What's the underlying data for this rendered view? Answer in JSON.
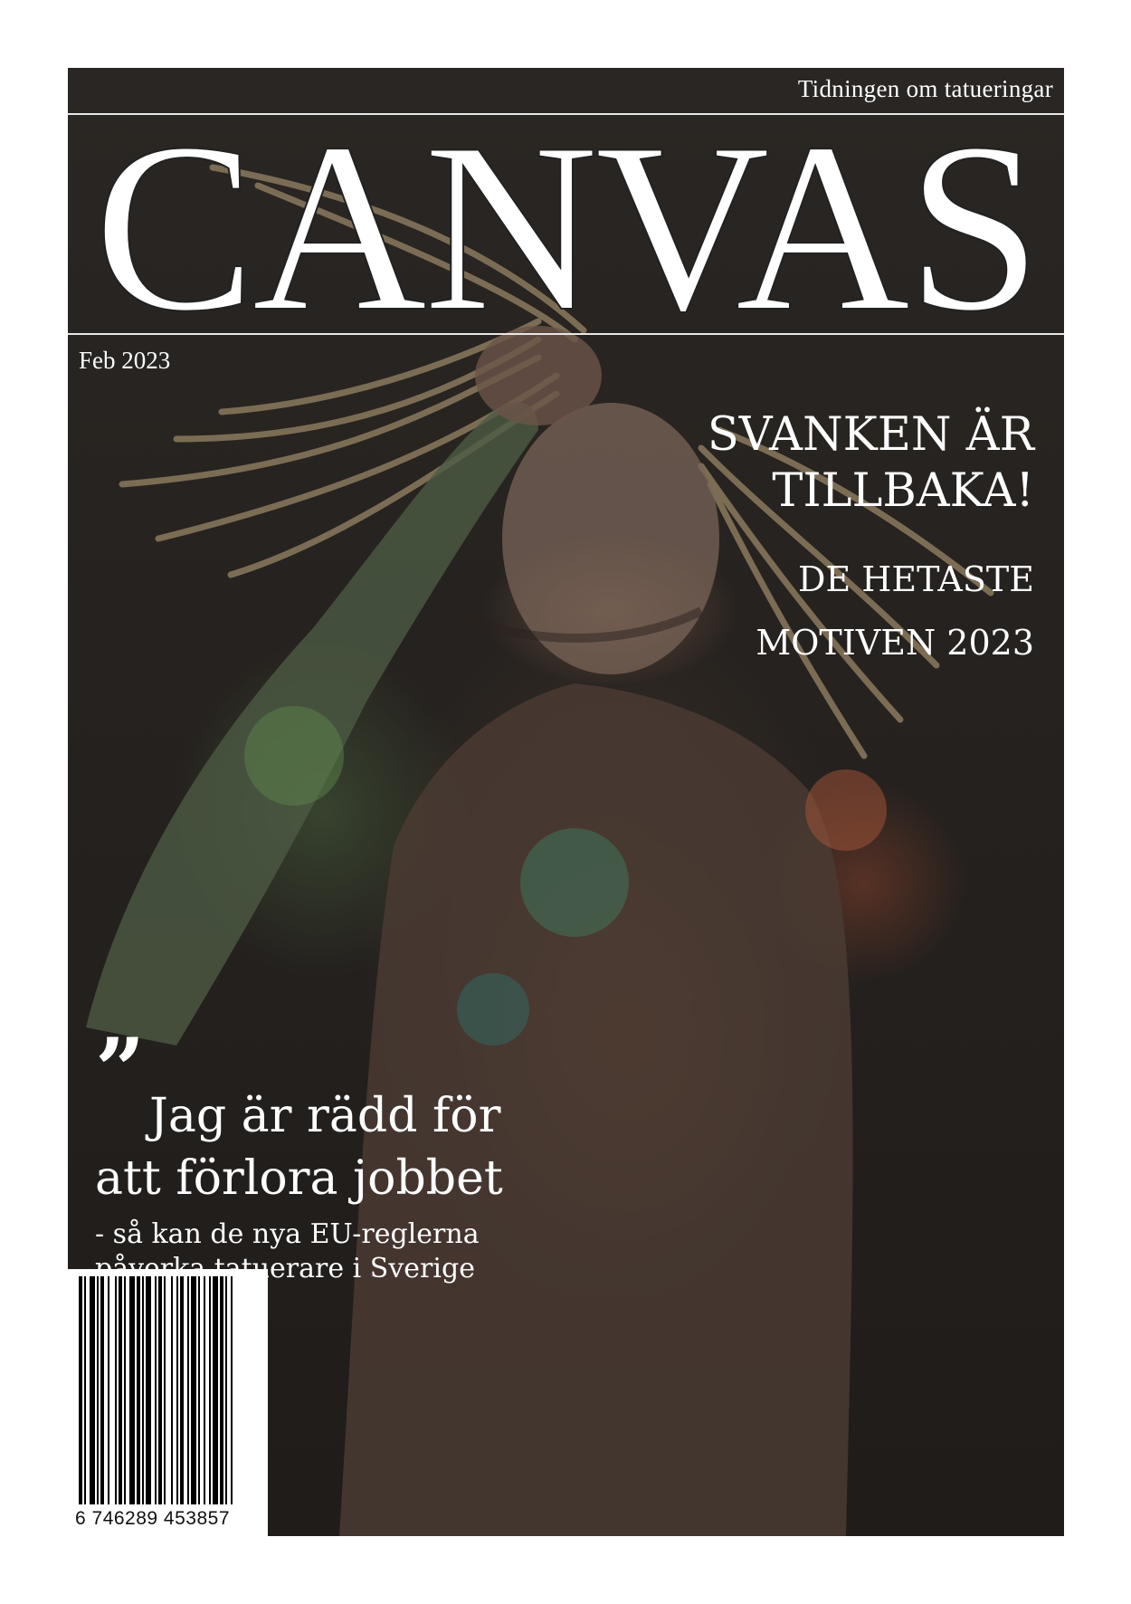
{
  "header": {
    "tagline": "Tidningen om tatueringar",
    "masthead": "CANVAS",
    "issue_date": "Feb 2023"
  },
  "cover_lines": {
    "headline_line1": "SVANKEN ÄR",
    "headline_line2": "TILLBAKA!",
    "subhead_line1": "DE HETASTE",
    "subhead_line2": "MOTIVEN 2023"
  },
  "feature": {
    "quote_mark": "”",
    "quote_line1": "Jag är rädd för",
    "quote_line2": "att förlora jobbet",
    "sub_line1": "- så kan de nya EU-reglerna",
    "sub_line2": "påverka tatuerare i Sverige"
  },
  "barcode": {
    "number": "6 746289 453857"
  },
  "colors": {
    "text": "#ffffff",
    "background": "#26221f",
    "page": "#ffffff"
  }
}
